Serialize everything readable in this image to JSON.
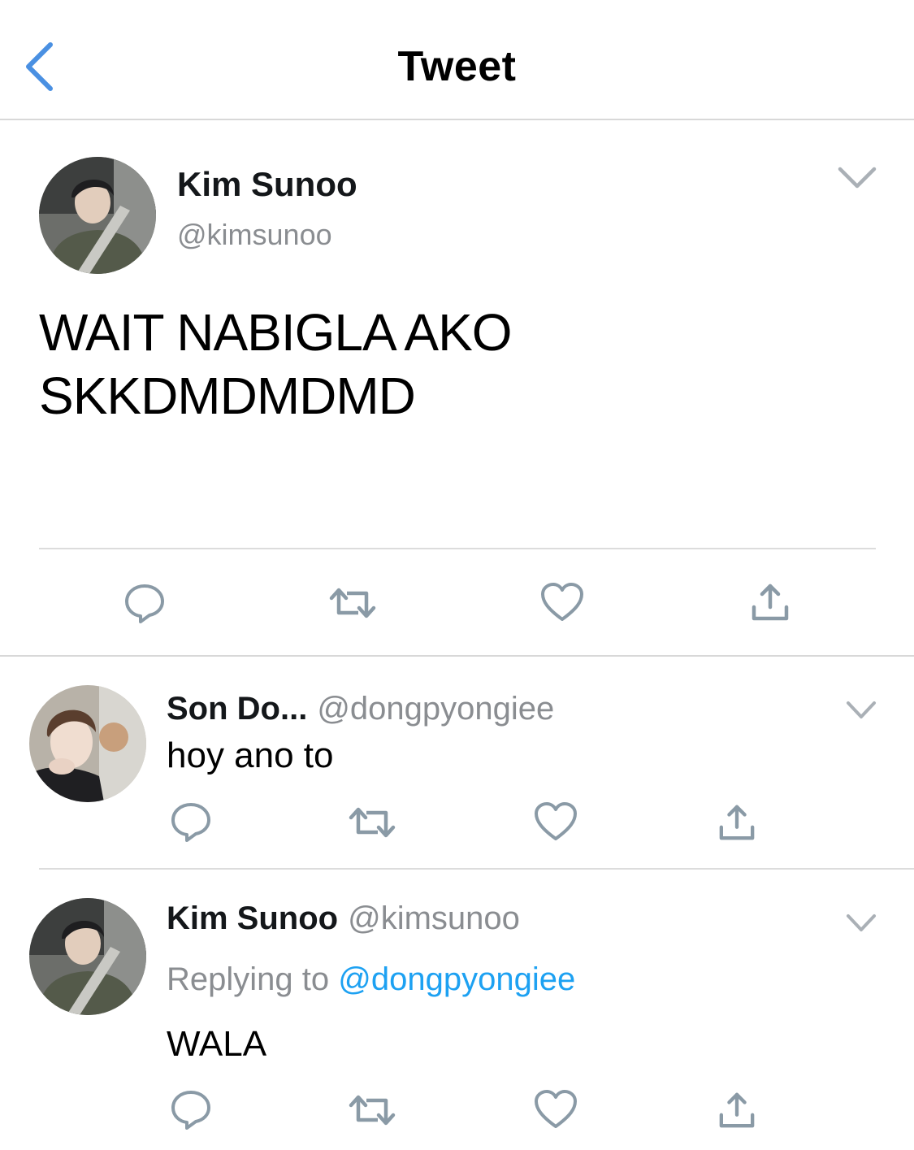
{
  "header": {
    "title": "Tweet",
    "back_icon": "chevron-left-icon"
  },
  "main_tweet": {
    "name": "Kim Sunoo",
    "handle": "@kimsunoo",
    "text_line1": "WAIT NABIGLA AKO",
    "text_line2": "SKKDMDMDMD",
    "actions": [
      "reply-icon",
      "retweet-icon",
      "like-icon",
      "share-icon"
    ]
  },
  "replies": [
    {
      "name": "Son Do...",
      "handle": "@dongpyongiee",
      "text": "hoy ano to"
    },
    {
      "name": "Kim Sunoo",
      "handle": "@kimsunoo",
      "replying_prefix": "Replying to",
      "replying_handle": "@dongpyongiee",
      "text": "WALA"
    }
  ],
  "colors": {
    "accent": "#1da1f2",
    "back_arrow": "#4a90e2",
    "secondary_text": "#8a8d91",
    "icon_gray": "#8a9aa6",
    "divider": "#d8d8d8"
  }
}
